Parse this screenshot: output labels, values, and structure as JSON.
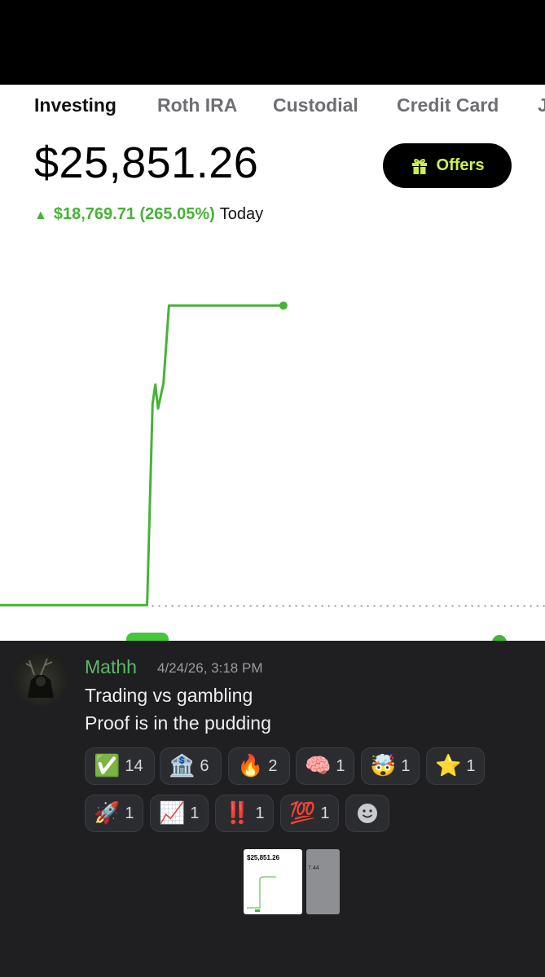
{
  "app": {
    "tabs": [
      "Investing",
      "Roth IRA",
      "Custodial",
      "Credit Card",
      "J"
    ],
    "active_tab": "Investing",
    "balance": "$25,851.26",
    "offers_label": "Offers",
    "change_amount": "$18,769.71 (265.05%)",
    "change_period": "Today",
    "accent_color": "#45b336",
    "offers_text_color": "#ccf04a"
  },
  "chart_data": {
    "type": "line",
    "title": "",
    "series": [
      {
        "values": [
          7081.55,
          7081.55,
          7081.55,
          19700,
          20900,
          19400,
          21000,
          25851.26,
          25851.26
        ]
      }
    ],
    "x": [
      0,
      0.1,
      0.27,
      0.28,
      0.285,
      0.29,
      0.3,
      0.31,
      0.52
    ],
    "baseline": 7081.55,
    "ylim": [
      5000,
      30000
    ],
    "grid": false,
    "legend": "none"
  },
  "message": {
    "username": "Mathh",
    "timestamp": "4/24/26, 3:18 PM",
    "lines": [
      "Trading vs gambling",
      "Proof is in the pudding"
    ],
    "reactions": [
      {
        "emoji": "✅",
        "count": "14"
      },
      {
        "emoji": "🏦",
        "count": "6"
      },
      {
        "emoji": "🔥",
        "count": "2"
      },
      {
        "emoji": "🧠",
        "count": "1"
      },
      {
        "emoji": "🤯",
        "count": "1"
      },
      {
        "emoji": "⭐",
        "count": "1"
      },
      {
        "emoji": "🚀",
        "count": "1"
      },
      {
        "emoji": "📈",
        "count": "1"
      },
      {
        "emoji": "‼️",
        "count": "1"
      },
      {
        "emoji": "💯",
        "count": "1"
      }
    ],
    "username_color": "#5fb86a"
  },
  "thumbnails": {
    "first_balance": "$25,851.26",
    "second_fragment": "7.44"
  }
}
